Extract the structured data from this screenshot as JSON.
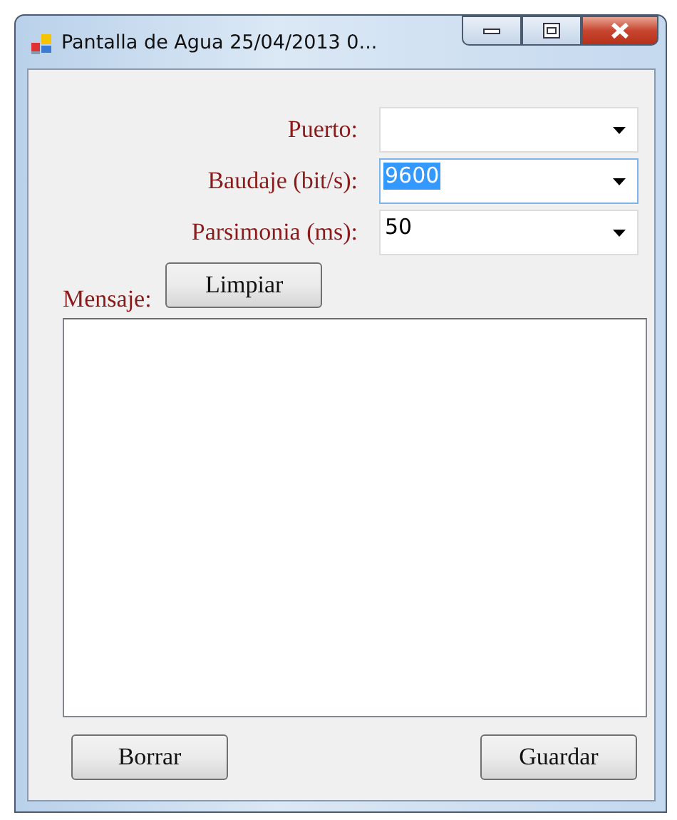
{
  "window": {
    "title": "Pantalla de Agua 25/04/2013 0..."
  },
  "settings": [
    {
      "label": "Puerto:",
      "focused": false
    },
    {
      "label": "Baudaje (bit/s):",
      "value": "9600",
      "focused": true
    },
    {
      "label": "Parsimonia (ms):",
      "value": "50",
      "focused": false
    }
  ],
  "message": {
    "label": "Mensaje:",
    "clear_button": "Limpiar"
  },
  "buttons": {
    "left": "Borrar",
    "right": "Guardar"
  }
}
